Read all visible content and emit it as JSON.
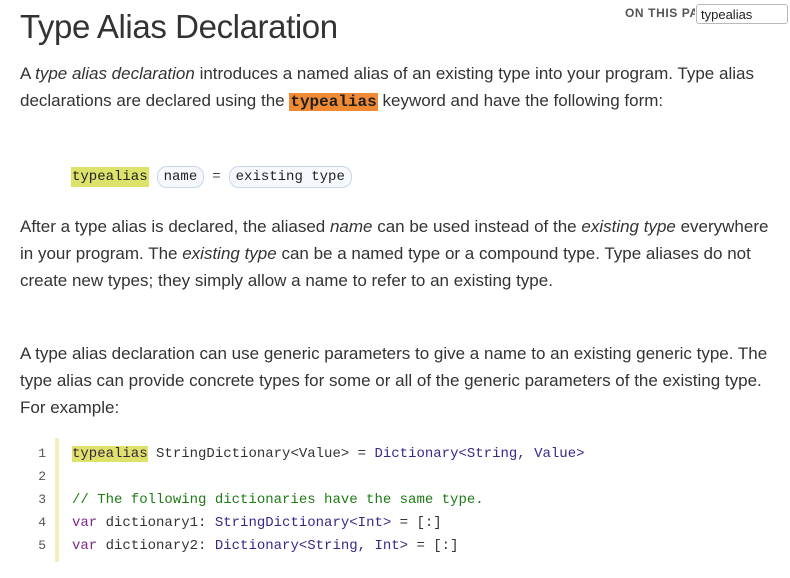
{
  "page": {
    "title": "Type Alias Declaration"
  },
  "header": {
    "on_this_page": "ON THIS PAGE",
    "search_value": "typealias"
  },
  "intro": {
    "p1_a": "A ",
    "p1_em1": "type alias declaration",
    "p1_b": " introduces a named alias of an existing type into your program. Type alias declarations are declared using the ",
    "p1_keyword": "typealias",
    "p1_c": " keyword and have the following form:"
  },
  "grammar": {
    "keyword": "typealias",
    "name": "name",
    "equals": "=",
    "existing_type": "existing type"
  },
  "para2": {
    "a": "After a type alias is declared, the aliased ",
    "em1": "name",
    "b": " can be used instead of the ",
    "em2": "existing type",
    "c": " everywhere in your program. The ",
    "em3": "existing type",
    "d": " can be a named type or a compound type. Type aliases do not create new types; they simply allow a name to refer to an existing type."
  },
  "para3": {
    "text": "A type alias declaration can use generic parameters to give a name to an existing generic type. The type alias can provide concrete types for some or all of the generic parameters of the existing type. For example:"
  },
  "code": {
    "line_numbers": [
      "1",
      "2",
      "3",
      "4",
      "5"
    ],
    "l1_kw": "typealias",
    "l1_rest_a": " StringDictionary<Value> = ",
    "l1_type": "Dictionary<String, Value>",
    "l3_comment": "// The following dictionaries have the same type.",
    "l4_kw": "var",
    "l4_rest_a": " dictionary1: ",
    "l4_type": "StringDictionary<Int>",
    "l4_rest_b": " = [:]",
    "l5_kw": "var",
    "l5_rest_a": " dictionary2: ",
    "l5_type": "Dictionary<String, Int>",
    "l5_rest_b": " = [:]"
  },
  "colors": {
    "keyword_highlight": "#f08b34",
    "code_keyword_highlight": "#dde36a",
    "comment": "#1f7a17",
    "keyword": "#7a2a84",
    "type": "#3a2888"
  }
}
